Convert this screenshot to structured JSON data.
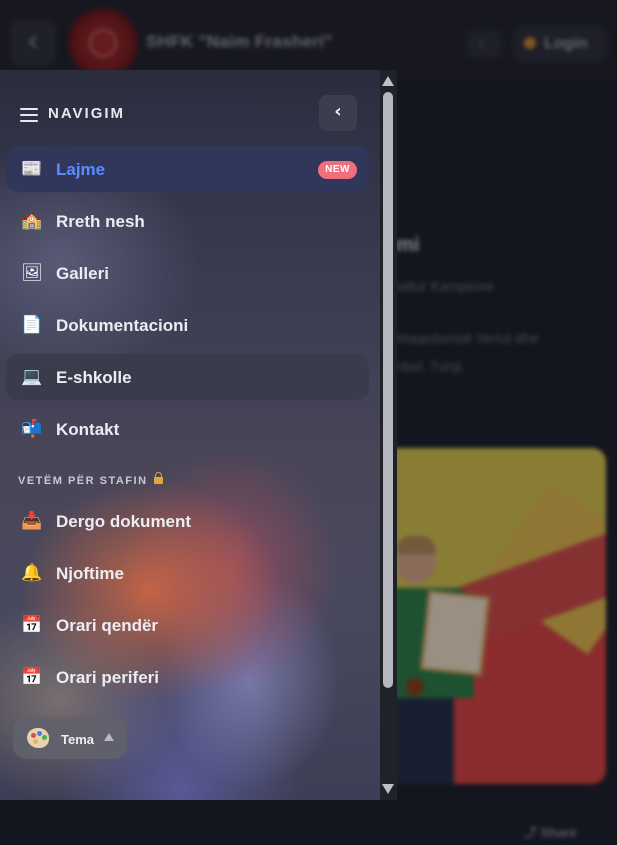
{
  "header": {
    "site_title": "SHFK \"Naim Frasheri\"",
    "login_label": "Login",
    "back_icon": "chevron-left-icon",
    "theme_icon": "moon-icon"
  },
  "article": {
    "title": "omi",
    "line1": "npaltur Kampione",
    "line2": "ë Maqedonisë Veriut dhe",
    "line3": "tanbol, Turqi.",
    "share_label": "Share"
  },
  "drawer": {
    "title": "NAVIGIM",
    "collapse_glyph": "‹",
    "items": [
      {
        "label": "Lajme",
        "icon": "newspaper-icon",
        "glyph": "📰",
        "badge": "NEW",
        "active": true
      },
      {
        "label": "Rreth nesh",
        "icon": "school-icon",
        "glyph": "🏫"
      },
      {
        "label": "Galleri",
        "icon": "picture-icon",
        "glyph": "🖼"
      },
      {
        "label": "Dokumentacioni",
        "icon": "document-icon",
        "glyph": "📄"
      },
      {
        "label": "E-shkolle",
        "icon": "laptop-icon",
        "glyph": "💻"
      },
      {
        "label": "Kontakt",
        "icon": "mailbox-icon",
        "glyph": "📬"
      }
    ],
    "staff_section_label": "VETËM PËR STAFIN",
    "staff_items": [
      {
        "label": "Dergo dokument",
        "icon": "inbox-tray-icon",
        "glyph": "📥"
      },
      {
        "label": "Njoftime",
        "icon": "bell-icon",
        "glyph": "🔔"
      },
      {
        "label": "Orari qendër",
        "icon": "calendar-icon",
        "glyph": "📅"
      },
      {
        "label": "Orari periferi",
        "icon": "calendar-icon",
        "glyph": "📅"
      }
    ],
    "theme_button_label": "Tema"
  },
  "colors": {
    "accent_blue": "#5b8cff",
    "badge_red": "#ef6f7a",
    "lock_gold": "#e2a63b"
  }
}
